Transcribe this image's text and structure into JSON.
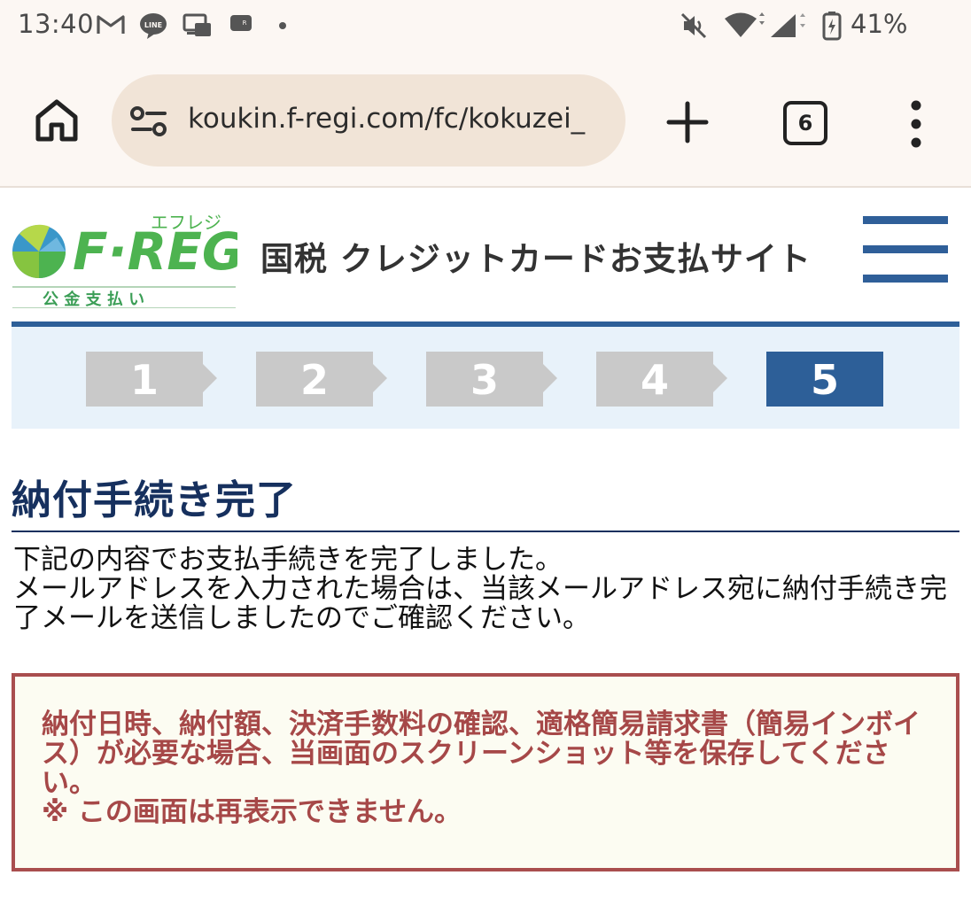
{
  "status_bar": {
    "time": "13:40",
    "battery": "41%",
    "icons": [
      "gmail-icon",
      "line-icon",
      "cast-icon",
      "rakuten-icon",
      "dot-icon",
      "mute-icon",
      "wifi-icon",
      "signal-icon",
      "battery-icon"
    ]
  },
  "browser": {
    "url": "koukin.f-regi.com/fc/kokuzei_",
    "tab_count": "6"
  },
  "site": {
    "logo_kana": "エフレジ",
    "logo_name": "F·REGI",
    "logo_sub": "公 金 支 払 い",
    "title": "国税 クレジットカードお支払サイト"
  },
  "steps": [
    "1",
    "2",
    "3",
    "4",
    "5"
  ],
  "active_step": 5,
  "page": {
    "title": "納付手続き完了",
    "message_line1": "下記の内容でお支払手続きを完了しました。",
    "message_line2": "メールアドレスを入力された場合は、当該メールアドレス宛に納付手続き完了メールを送信しましたのでご確認ください。",
    "notice_line1": "納付日時、納付額、決済手数料の確認、適格簡易請求書（簡易インボイス）が必要な場合、当画面のスクリーンショット等を保存してください。",
    "notice_line2": "※ この画面は再表示できません。"
  },
  "colors": {
    "brand_blue": "#2d5f98",
    "title_navy": "#16305e",
    "notice_red": "#a64848",
    "logo_green": "#4db350",
    "step_inactive": "#c9c9c9"
  }
}
